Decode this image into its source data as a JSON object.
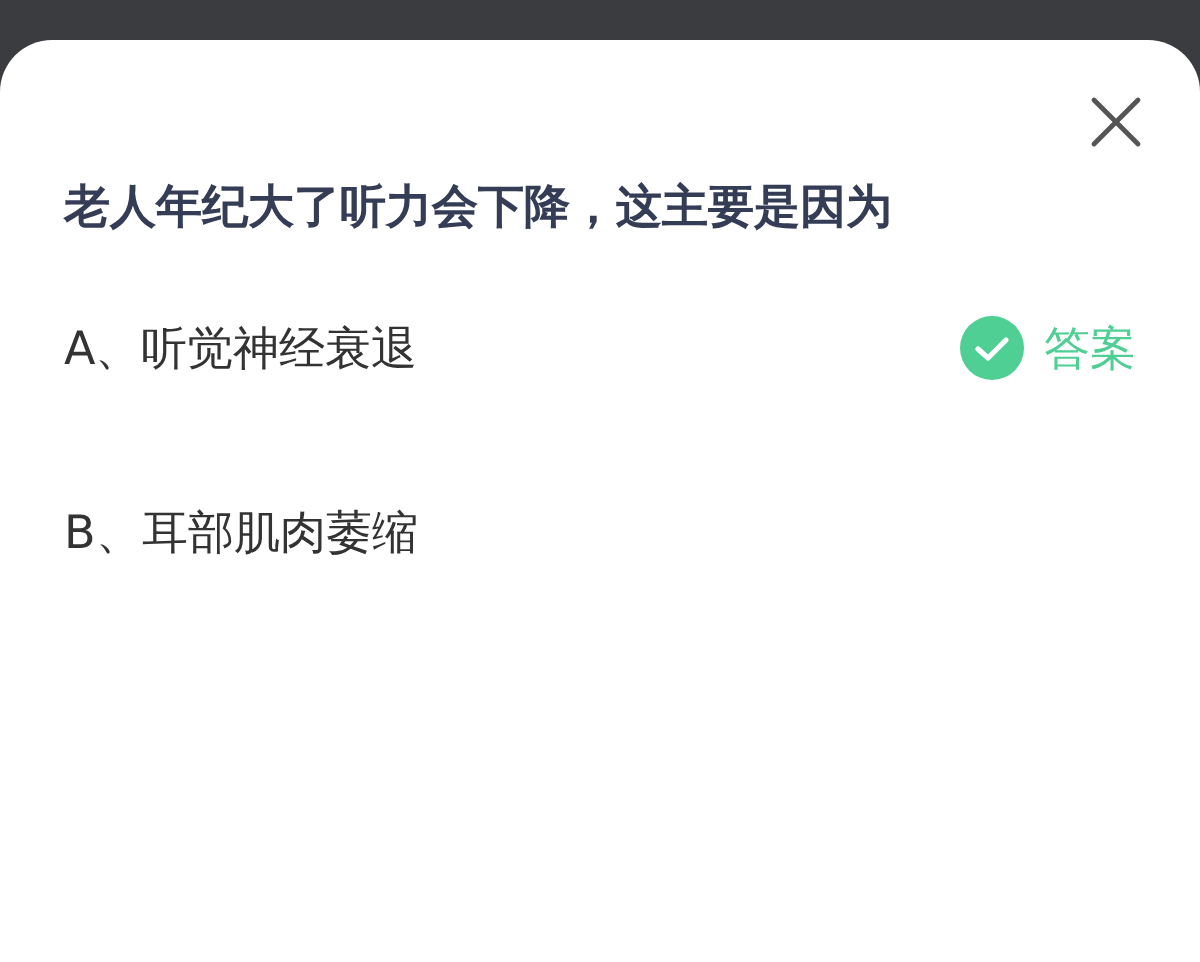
{
  "question": "老人年纪大了听力会下降，这主要是因为",
  "answer_badge": "答案",
  "options": [
    {
      "label": "A、听觉神经衰退",
      "correct": true
    },
    {
      "label": "B、耳部肌肉萎缩",
      "correct": false
    }
  ]
}
